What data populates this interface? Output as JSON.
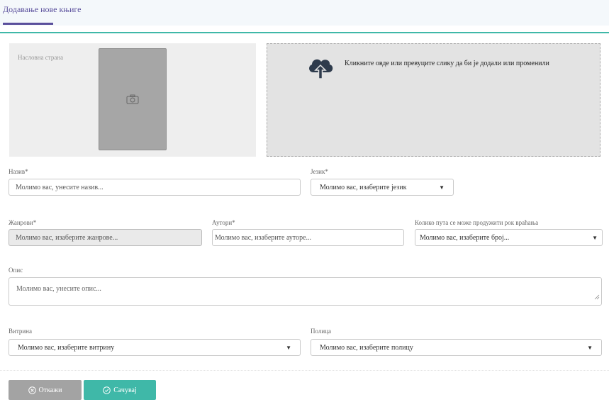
{
  "header": {
    "title": "Додавање нове књиге"
  },
  "cover": {
    "label": "Насловна страна"
  },
  "dropzone": {
    "text": "Кликните овде или превуците слику да би је додали или променили"
  },
  "fields": {
    "name": {
      "label": "Назив*",
      "placeholder": "Молимо вас, унесите назив..."
    },
    "language": {
      "label": "Језик*",
      "value": "Молимо вас, изаберите језик"
    },
    "genres": {
      "label": "Жанрови*",
      "placeholder": "Молимо вас, изаберите жанрове..."
    },
    "authors": {
      "label": "Аутори*",
      "placeholder": "Молимо вас, изаберите ауторе..."
    },
    "extensions": {
      "label": "Колико пута се може продужити рок враћања",
      "value": "Молимо вас, изаберите број..."
    },
    "description": {
      "label": "Опис",
      "placeholder": "Молимо вас, унесите опис..."
    },
    "showcase": {
      "label": "Витрина",
      "value": "Молимо вас, изаберите витрину"
    },
    "shelf": {
      "label": "Полица",
      "value": "Молимо вас, изаберите полицу"
    }
  },
  "buttons": {
    "cancel": "Откажи",
    "save": "Сачувај"
  },
  "colors": {
    "accent": "#5a4f9c",
    "teal": "#3fb8a8",
    "cancel": "#a3a3a3"
  },
  "icons": {
    "camera": "camera-icon",
    "upload": "cloud-upload-icon",
    "cancel": "circle-x-icon",
    "save": "circle-check-icon"
  }
}
